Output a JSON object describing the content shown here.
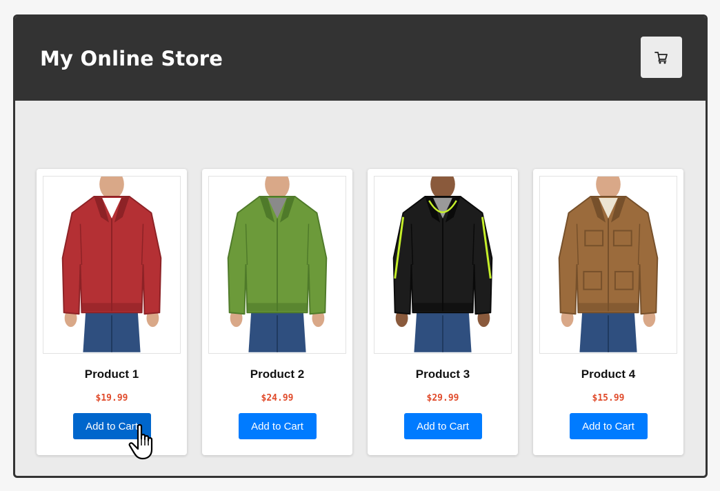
{
  "header": {
    "title": "My Online Store",
    "cart_icon": "shopping-cart-icon"
  },
  "products": [
    {
      "name": "Product 1",
      "price": "$19.99",
      "button_label": "Add to Cart",
      "jacket_color": "#b43034",
      "jacket_dark": "#8d2226",
      "collar": "#ffffff",
      "button_state": "hover"
    },
    {
      "name": "Product 2",
      "price": "$24.99",
      "button_label": "Add to Cart",
      "jacket_color": "#6c9a3a",
      "jacket_dark": "#4f7a2a",
      "collar": "#8a8a8a",
      "button_state": "normal"
    },
    {
      "name": "Product 3",
      "price": "$29.99",
      "button_label": "Add to Cart",
      "jacket_color": "#1c1c1c",
      "jacket_dark": "#0a0a0a",
      "collar": "#9a9a9a",
      "button_state": "normal"
    },
    {
      "name": "Product 4",
      "price": "$15.99",
      "button_label": "Add to Cart",
      "jacket_color": "#9b6b3c",
      "jacket_dark": "#76502b",
      "collar": "#ece4d2",
      "button_state": "normal"
    }
  ],
  "colors": {
    "header_bg": "#333333",
    "button_blue": "#007bff",
    "button_hover": "#0066cc",
    "price_red": "#e04a2a",
    "trim_lime": "#c6f02a"
  },
  "cursor_icon": "hand-pointer-icon"
}
